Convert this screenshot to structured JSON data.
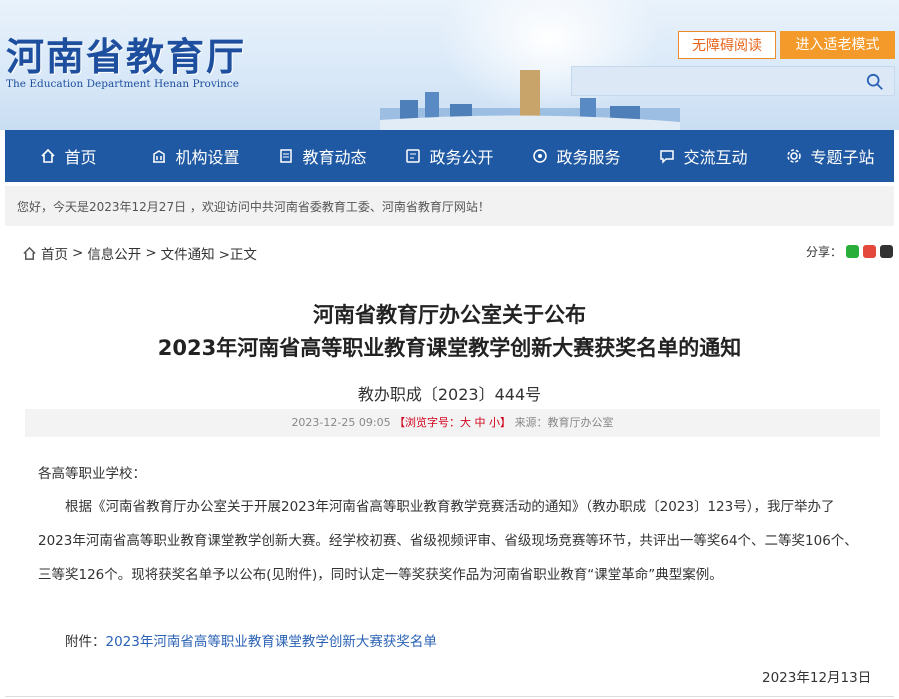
{
  "header": {
    "site_title": "河南省教育厅",
    "site_subtitle": "The Education Department Henan Province",
    "accessible_label": "无障碍阅读",
    "elder_mode_label": "进入适老模式",
    "search_placeholder": ""
  },
  "nav": {
    "items": [
      {
        "label": "首页",
        "icon": "home-icon"
      },
      {
        "label": "机构设置",
        "icon": "building-icon"
      },
      {
        "label": "教育动态",
        "icon": "document-icon"
      },
      {
        "label": "政务公开",
        "icon": "file-icon"
      },
      {
        "label": "政务服务",
        "icon": "service-icon"
      },
      {
        "label": "交流互动",
        "icon": "chat-icon"
      },
      {
        "label": "专题子站",
        "icon": "gear-icon"
      }
    ]
  },
  "greeting": "您好，今天是2023年12月27日 ，欢迎访问中共河南省委教育工委、河南省教育厅网站！",
  "breadcrumb": {
    "home": "首页",
    "sep": ">",
    "level1": "信息公开",
    "level2": "文件通知",
    "current": ">正文"
  },
  "share_label": "分享：",
  "article": {
    "title_line1": "河南省教育厅办公室关于公布",
    "title_line2": "2023年河南省高等职业教育课堂教学创新大赛获奖名单的通知",
    "doc_number": "教办职成〔2023〕444号",
    "meta_date": "2023-12-25 09:05",
    "meta_fontsize": "【浏览字号：大 中 小】",
    "meta_source": "来源：教育厅办公室",
    "addressee": "各高等职业学校：",
    "body": "根据《河南省教育厅办公室关于开展2023年河南省高等职业教育教学竞赛活动的通知》（教办职成〔2023〕123号），我厅举办了2023年河南省高等职业教育课堂教学创新大赛。经学校初赛、省级视频评审、省级现场竞赛等环节，共评出一等奖64个、二等奖106个、三等奖126个。现将获奖名单予以公布(见附件)，同时认定一等奖获奖作品为河南省职业教育“课堂革命”典型案例。",
    "attachment_label": "附件：",
    "attachment_link": "2023年河南省高等职业教育课堂教学创新大赛获奖名单",
    "date": "2023年12月13日"
  }
}
